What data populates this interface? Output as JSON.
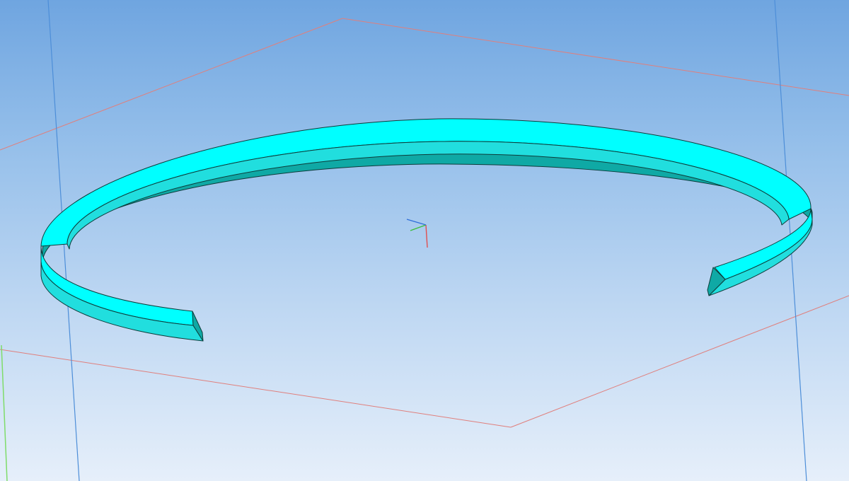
{
  "viewport": {
    "background_top": "#6fa5e0",
    "background_bottom": "#e6effa"
  },
  "scene": {
    "model_type": "split ring",
    "colors": {
      "face_light": "#00ffff",
      "face_mid": "#21dede",
      "face_dark": "#0fa9a5",
      "edge": "#0d3c3a",
      "plane_lines": "#e07f7c",
      "vertical_lines": "#4d8ed8",
      "axis_x": "#e24c4c",
      "axis_y": "#3bbf3b",
      "axis_z": "#2f6fd9",
      "left_edge_line": "#7fdc6a"
    }
  }
}
